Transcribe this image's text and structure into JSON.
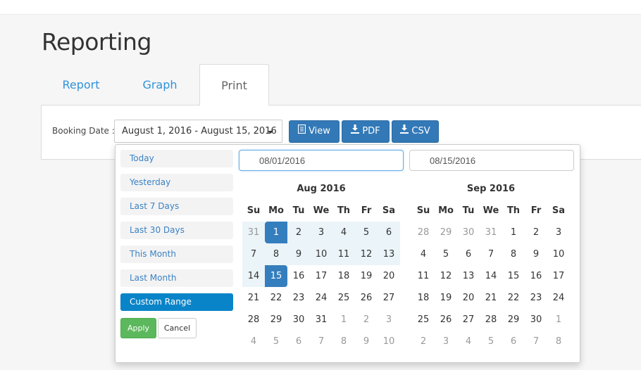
{
  "page": {
    "title": "Reporting"
  },
  "tabs": [
    {
      "label": "Report"
    },
    {
      "label": "Graph"
    },
    {
      "label": "Print"
    }
  ],
  "filter": {
    "label": "Booking Date :",
    "range_value": "August 1, 2016 - August 15, 2016",
    "buttons": {
      "view": "View",
      "pdf": "PDF",
      "csv": "CSV"
    }
  },
  "picker": {
    "ranges": [
      "Today",
      "Yesterday",
      "Last 7 Days",
      "Last 30 Days",
      "This Month",
      "Last Month",
      "Custom Range"
    ],
    "active_range": "Custom Range",
    "apply_label": "Apply",
    "cancel_label": "Cancel",
    "start_input": "08/01/2016",
    "end_input": "08/15/2016",
    "weekdays": [
      "Su",
      "Mo",
      "Tu",
      "We",
      "Th",
      "Fr",
      "Sa"
    ],
    "selected_start": "2016-08-01",
    "selected_end": "2016-08-15",
    "calendars": [
      {
        "title": "Aug 2016",
        "weeks": [
          [
            "31",
            "1",
            "2",
            "3",
            "4",
            "5",
            "6"
          ],
          [
            "7",
            "8",
            "9",
            "10",
            "11",
            "12",
            "13"
          ],
          [
            "14",
            "15",
            "16",
            "17",
            "18",
            "19",
            "20"
          ],
          [
            "21",
            "22",
            "23",
            "24",
            "25",
            "26",
            "27"
          ],
          [
            "28",
            "29",
            "30",
            "31",
            "1",
            "2",
            "3"
          ],
          [
            "4",
            "5",
            "6",
            "7",
            "8",
            "9",
            "10"
          ]
        ]
      },
      {
        "title": "Sep 2016",
        "weeks": [
          [
            "28",
            "29",
            "30",
            "31",
            "1",
            "2",
            "3"
          ],
          [
            "4",
            "5",
            "6",
            "7",
            "8",
            "9",
            "10"
          ],
          [
            "11",
            "12",
            "13",
            "14",
            "15",
            "16",
            "17"
          ],
          [
            "18",
            "19",
            "20",
            "21",
            "22",
            "23",
            "24"
          ],
          [
            "25",
            "26",
            "27",
            "28",
            "29",
            "30",
            "1"
          ],
          [
            "2",
            "3",
            "4",
            "5",
            "6",
            "7",
            "8"
          ]
        ]
      }
    ]
  },
  "colors": {
    "accent": "#3379b7",
    "link": "#2f93d7",
    "range_active": "#0a84c8",
    "apply": "#5cb85c",
    "in_range": "#ebf4f8"
  }
}
